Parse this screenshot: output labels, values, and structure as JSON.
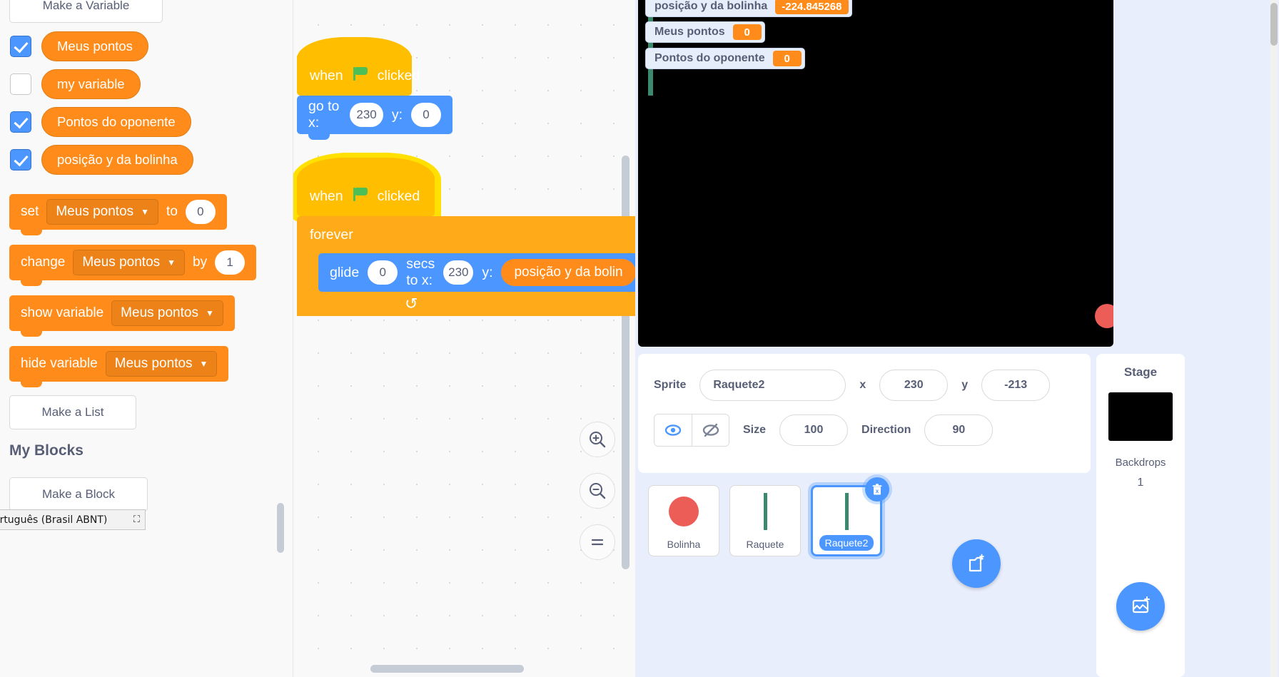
{
  "palette": {
    "make_variable_label": "Make a Variable",
    "variables": [
      {
        "name": "Meus pontos",
        "checked": true
      },
      {
        "name": "my variable",
        "checked": false
      },
      {
        "name": "Pontos do oponente",
        "checked": true
      },
      {
        "name": "posição y da bolinha",
        "checked": true
      }
    ],
    "blocks": {
      "set_label": "set",
      "set_variable": "Meus pontos",
      "set_to_label": "to",
      "set_value": "0",
      "change_label": "change",
      "change_variable": "Meus pontos",
      "change_by_label": "by",
      "change_value": "1",
      "show_label": "show variable",
      "show_variable": "Meus pontos",
      "hide_label": "hide variable",
      "hide_variable": "Meus pontos"
    },
    "make_list_label": "Make a List",
    "my_blocks_heading": "My Blocks",
    "make_block_label": "Make a Block",
    "ime_language": "ortuguês (Brasil ABNT)"
  },
  "canvas": {
    "script1": {
      "hat_when": "when",
      "hat_clicked": "clicked",
      "goto_label": "go to x:",
      "goto_x": "230",
      "goto_y_label": "y:",
      "goto_y": "0"
    },
    "script2": {
      "hat_when": "when",
      "hat_clicked": "clicked",
      "forever_label": "forever",
      "glide_label": "glide",
      "glide_secs": "0",
      "glide_secs_label": "secs to x:",
      "glide_x": "230",
      "glide_y_label": "y:",
      "glide_y_variable": "posição y da bolin"
    }
  },
  "stage": {
    "monitors": [
      {
        "name": "posição y da bolinha",
        "value": "-224.845268"
      },
      {
        "name": "Meus pontos",
        "value": "0"
      },
      {
        "name": "Pontos do oponente",
        "value": "0"
      }
    ]
  },
  "sprite_info": {
    "sprite_label": "Sprite",
    "sprite_name": "Raquete2",
    "x_label": "x",
    "x_value": "230",
    "y_label": "y",
    "y_value": "-213",
    "size_label": "Size",
    "size_value": "100",
    "direction_label": "Direction",
    "direction_value": "90"
  },
  "sprites": [
    {
      "name": "Bolinha",
      "type": "ball",
      "selected": false
    },
    {
      "name": "Raquete",
      "type": "paddle",
      "selected": false
    },
    {
      "name": "Raquete2",
      "type": "paddle",
      "selected": true
    }
  ],
  "stage_panel": {
    "title": "Stage",
    "backdrops_label": "Backdrops",
    "backdrops_count": "1"
  },
  "colors": {
    "variable_orange": "#ff8c1a",
    "motion_blue": "#4c97ff",
    "events_yellow": "#ffbf00",
    "control_orange": "#ffab19",
    "glow_yellow": "#ffe000"
  }
}
